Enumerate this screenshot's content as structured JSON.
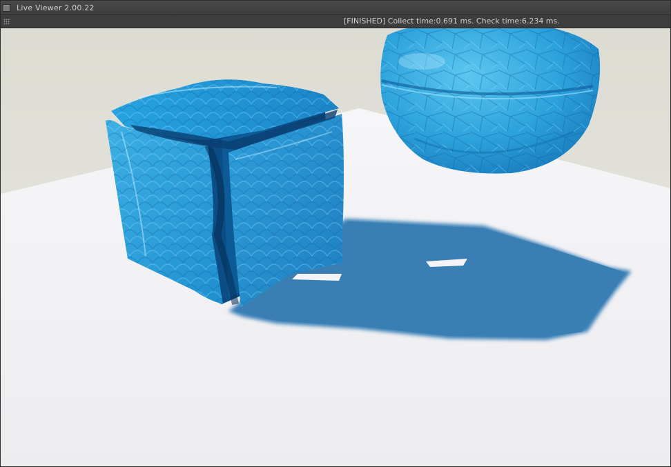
{
  "window": {
    "title": "Live Viewer 2.00.22",
    "icon": "window-menu-icon"
  },
  "statusbar": {
    "grip_icon": "grip-icon",
    "text": "[FINISHED] Collect time:0.691 ms.  Check time:6.234 ms."
  },
  "viewport": {
    "scene": "render-preview",
    "colors": {
      "background": "#e6e6df",
      "floor": "#f3f3f6",
      "object_blue": "#2ea3dc",
      "object_dark": "#0a4f86",
      "shadow": "#3a7fb4"
    }
  }
}
